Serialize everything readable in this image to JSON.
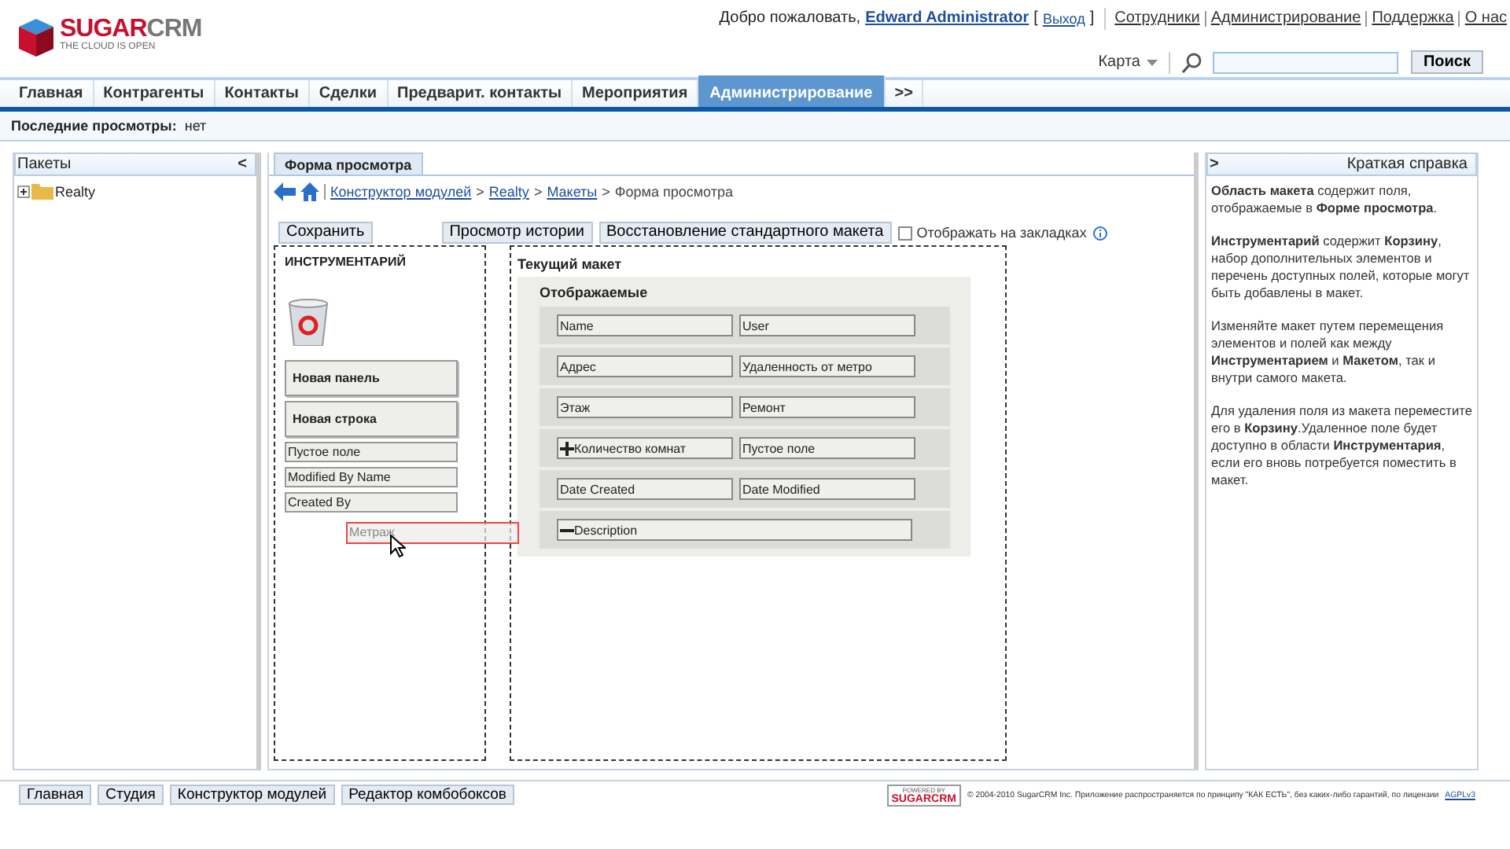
{
  "header": {
    "logo": {
      "word_a": "SUGAR",
      "word_b": "CRM",
      "tagline": "THE CLOUD IS OPEN"
    },
    "welcome": "Добро пожаловать,",
    "user": "Edward Administrator",
    "logout": "Выход",
    "bracket_open": "[",
    "bracket_close": "]",
    "links": [
      "Сотрудники",
      "Администрирование",
      "Поддержка",
      "О нас"
    ],
    "search": {
      "menu_label": "Карта",
      "button": "Поиск"
    }
  },
  "tabs": [
    {
      "label": "Главная",
      "selected": false
    },
    {
      "label": "Контрагенты",
      "selected": false
    },
    {
      "label": "Контакты",
      "selected": false
    },
    {
      "label": "Сделки",
      "selected": false
    },
    {
      "label": "Предварит. контакты",
      "selected": false
    },
    {
      "label": "Мероприятия",
      "selected": false
    },
    {
      "label": "Администрирование",
      "selected": true
    },
    {
      "label": ">>",
      "selected": false
    }
  ],
  "recent": {
    "label": "Последние просмотры:",
    "value": "нет"
  },
  "packages": {
    "title": "Пакеты",
    "collapse": "<",
    "tree": [
      {
        "label": "Realty",
        "expanded": false
      }
    ]
  },
  "editor": {
    "tab": "Форма просмотра",
    "breadcrumb": {
      "links": [
        "Конструктор модулей",
        "Realty",
        "Макеты"
      ],
      "separator": ">",
      "current": "Форма просмотра"
    },
    "buttons": [
      {
        "label": "Сохранить",
        "kind": "left"
      },
      {
        "label": "Просмотр истории",
        "kind": "right"
      },
      {
        "label": "Восстановление стандартного макета",
        "kind": "right"
      }
    ],
    "tabs_checkbox": {
      "label": "Отображать на закладках",
      "checked": false
    },
    "toolbox": {
      "title": "ИНСТРУМЕНТАРИЙ",
      "items": [
        {
          "label": "Новая панель",
          "kind": "block"
        },
        {
          "label": "Новая строка",
          "kind": "block"
        },
        {
          "label": "Пустое поле",
          "kind": "field"
        },
        {
          "label": "Modified By Name",
          "kind": "field"
        },
        {
          "label": "Created By",
          "kind": "field"
        }
      ],
      "dragged": "Метраж"
    },
    "layout": {
      "title": "Текущий макет",
      "panel": "Отображаемые",
      "rows": [
        {
          "fields": [
            {
              "label": "Name"
            },
            {
              "label": "User"
            }
          ]
        },
        {
          "fields": [
            {
              "label": "Адрес"
            },
            {
              "label": "Удаленность от метро"
            }
          ]
        },
        {
          "fields": [
            {
              "label": "Этаж"
            },
            {
              "label": "Ремонт"
            }
          ]
        },
        {
          "fields": [
            {
              "label": "Количество комнат",
              "kind": "expandable"
            },
            {
              "label": "Пустое поле"
            }
          ]
        },
        {
          "fields": [
            {
              "label": "Date Created"
            },
            {
              "label": "Date Modified"
            }
          ]
        },
        {
          "fields": [
            {
              "label": "Description",
              "kind": "collapsible",
              "wide": true
            }
          ]
        }
      ]
    }
  },
  "help": {
    "expand": ">",
    "title": "Краткая справка",
    "paragraphs": [
      "**Область макета** содержит поля, отображаемые в **Форме просмотра**.",
      "**Инструментарий** содержит **Корзину**, набор дополнительных элементов и перечень доступных полей, которые могут быть добавлены в макет.",
      "Изменяйте макет путем перемещения элементов и полей как между **Инструментарием** и **Макетом**, так и внутри самого макета.",
      "Для удаления поля из макета переместите его в **Корзину**.Удаленное поле будет доступно в области **Инструментария**, если его вновь потребуется поместить в макет."
    ]
  },
  "footer": {
    "buttons": [
      "Главная",
      "Студия",
      "Конструктор модулей",
      "Редактор комбобоксов"
    ],
    "powered": {
      "top": "POWERED BY",
      "brand": "SUGARCRM"
    },
    "copyright": "© 2004-2010 SugarCRM Inc. Приложение распространяется по принципу \"КАК ЕСТЬ\", без каких-либо гарантий, по лицензии",
    "license": "AGPLv3"
  }
}
